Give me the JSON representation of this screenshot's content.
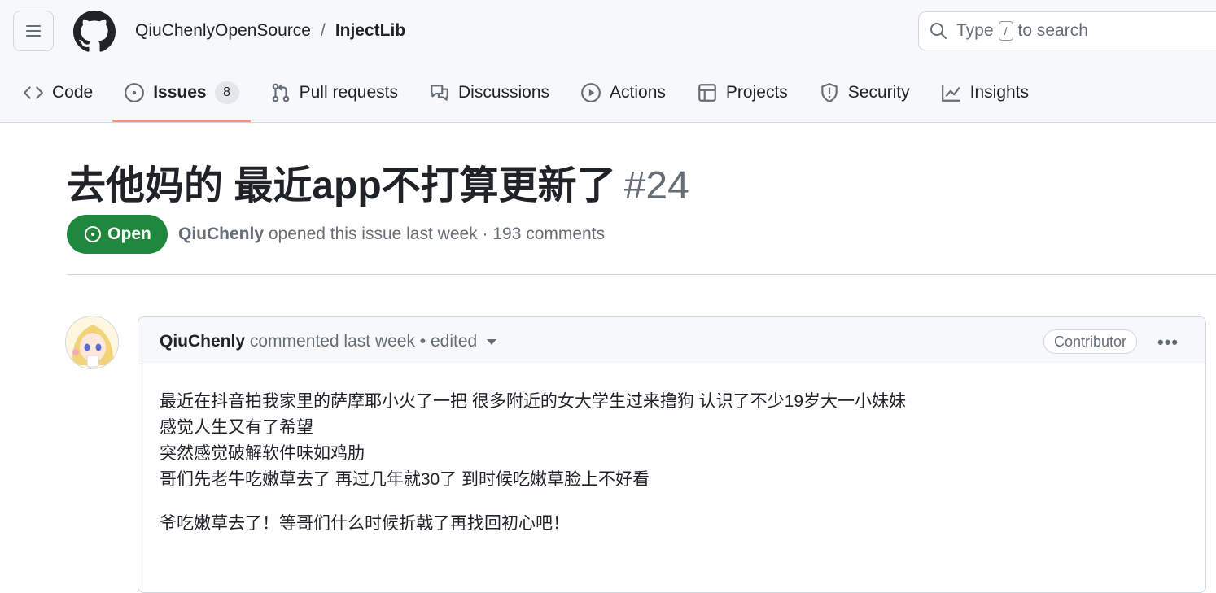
{
  "header": {
    "owner": "QiuChenlyOpenSource",
    "separator": "/",
    "repo": "InjectLib",
    "search": {
      "before": "Type",
      "key": "/",
      "after": "to search"
    }
  },
  "tabs": [
    {
      "label": "Code",
      "icon": "code-icon"
    },
    {
      "label": "Issues",
      "icon": "issue-opened-icon",
      "count": "8",
      "active": true
    },
    {
      "label": "Pull requests",
      "icon": "git-pull-request-icon"
    },
    {
      "label": "Discussions",
      "icon": "comment-discussion-icon"
    },
    {
      "label": "Actions",
      "icon": "play-icon"
    },
    {
      "label": "Projects",
      "icon": "table-icon"
    },
    {
      "label": "Security",
      "icon": "shield-icon"
    },
    {
      "label": "Insights",
      "icon": "graph-icon"
    }
  ],
  "issue": {
    "title": "去他妈的 最近app不打算更新了",
    "number": "#24",
    "state": "Open",
    "author": "QiuChenly",
    "meta_text": "opened this issue last week · 193 comments"
  },
  "comment": {
    "author": "QiuChenly",
    "action": "commented last week • edited",
    "badge": "Contributor",
    "more": "•••",
    "lines": [
      "最近在抖音拍我家里的萨摩耶小火了一把 很多附近的女大学生过来撸狗 认识了不少19岁大一小妹妹",
      "感觉人生又有了希望",
      "突然感觉破解软件味如鸡肋",
      "哥们先老牛吃嫩草去了 再过几年就30了 到时候吃嫩草脸上不好看"
    ],
    "closing": "爷吃嫩草去了！等哥们什么时候折戟了再找回初心吧！"
  },
  "colors": {
    "open_green": "#1f883d",
    "active_tab_underline": "#fd8c73",
    "muted_text": "#656d76"
  }
}
